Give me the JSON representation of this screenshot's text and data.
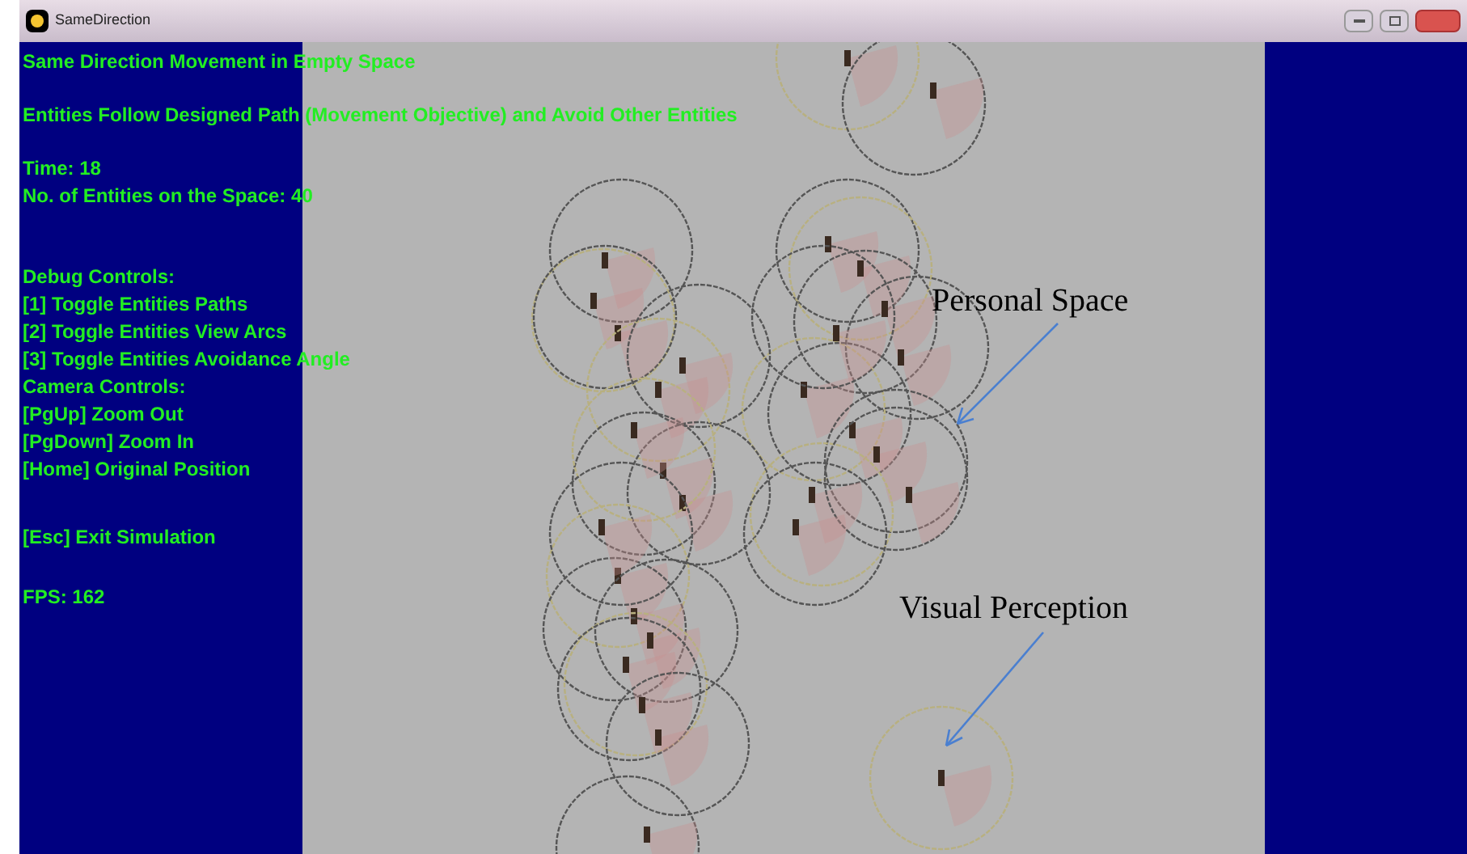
{
  "window": {
    "title": "SameDirection"
  },
  "hud": {
    "groups": [
      [
        "Same Direction Movement in Empty Space"
      ],
      [
        "Entities Follow Designed Path (Movement Objective) and Avoid Other Entities"
      ],
      [
        "Time: 18",
        "No. of Entities on the Space: 40"
      ],
      [
        "Debug Controls:",
        "[1] Toggle Entities Paths",
        "[2] Toggle Entities View Arcs",
        "[3] Toggle Entities Avoidance Angle",
        "Camera Controls:",
        "[PgUp] Zoom Out",
        "[PgDown] Zoom In",
        "[Home] Original Position"
      ],
      [
        "[Esc] Exit Simulation"
      ],
      [
        "FPS: 162"
      ]
    ]
  },
  "annotations": [
    {
      "text": "Personal Space"
    },
    {
      "text": "Visual Perception"
    }
  ]
}
